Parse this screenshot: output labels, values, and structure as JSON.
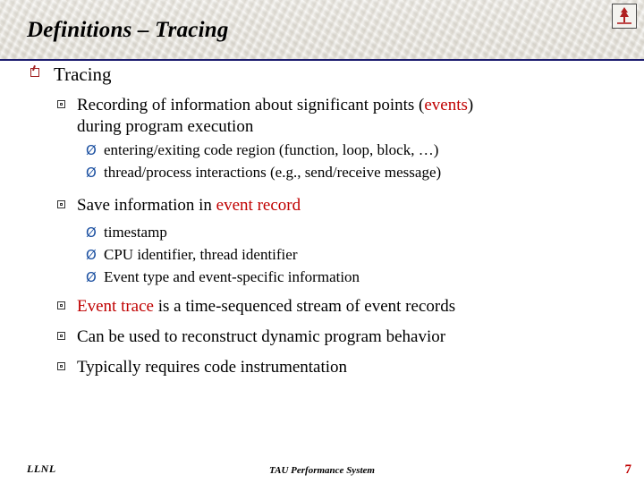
{
  "header": {
    "title": "Definitions – Tracing",
    "logo_icon": "llnl-logo-icon"
  },
  "slide": {
    "level1": {
      "text": "Tracing",
      "bullet_icon": "square-flag-bullet-icon"
    },
    "blocks": [
      {
        "level2": {
          "bullet_icon": "square-bullet-icon",
          "parts": [
            {
              "text": "Recording of information about significant points (",
              "color": "#000000"
            },
            {
              "text": "events",
              "color": "#c00000"
            },
            {
              "text": ")",
              "color": "#000000"
            }
          ],
          "line2": "during program execution"
        },
        "level3": [
          {
            "bullet_icon": "arrow-bullet-icon",
            "glyph": "Ø",
            "text": "entering/exiting code region (function, loop, block, …)"
          },
          {
            "bullet_icon": "arrow-bullet-icon",
            "glyph": "Ø",
            "text": "thread/process interactions (e.g., send/receive message)"
          }
        ]
      },
      {
        "level2": {
          "bullet_icon": "square-bullet-icon",
          "parts": [
            {
              "text": "Save information in ",
              "color": "#000000"
            },
            {
              "text": "event record",
              "color": "#c00000"
            }
          ],
          "line2": ""
        },
        "level3": [
          {
            "bullet_icon": "arrow-bullet-icon",
            "glyph": "Ø",
            "text": "timestamp"
          },
          {
            "bullet_icon": "arrow-bullet-icon",
            "glyph": "Ø",
            "text": "CPU identifier, thread identifier"
          },
          {
            "bullet_icon": "arrow-bullet-icon",
            "glyph": "Ø",
            "text": "Event type and event-specific information"
          }
        ]
      },
      {
        "level2": {
          "bullet_icon": "square-bullet-icon",
          "parts": [
            {
              "text": "Event trace",
              "color": "#c00000"
            },
            {
              "text": " is a time-sequenced stream of event records",
              "color": "#000000"
            }
          ],
          "line2": ""
        },
        "level3": []
      },
      {
        "level2": {
          "bullet_icon": "square-bullet-icon",
          "parts": [
            {
              "text": "Can be used to reconstruct dynamic program behavior",
              "color": "#000000"
            }
          ],
          "line2": ""
        },
        "level3": []
      },
      {
        "level2": {
          "bullet_icon": "square-bullet-icon",
          "parts": [
            {
              "text": "Typically requires code instrumentation",
              "color": "#000000"
            }
          ],
          "line2": ""
        },
        "level3": []
      }
    ]
  },
  "footer": {
    "left": "LLNL",
    "center": "TAU Performance System",
    "page_number": "7"
  }
}
